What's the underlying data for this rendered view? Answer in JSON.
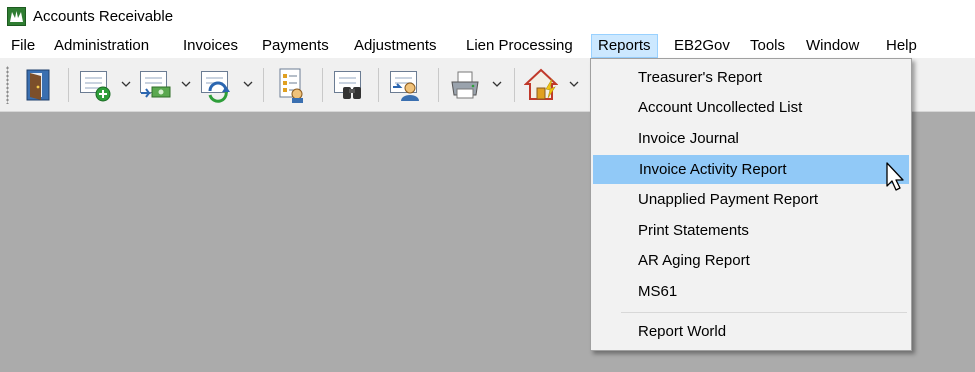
{
  "window": {
    "title": "Accounts Receivable",
    "app_icon": "app-logo-icon"
  },
  "menubar": {
    "items": [
      {
        "label": "File"
      },
      {
        "label": "Administration"
      },
      {
        "label": "Invoices"
      },
      {
        "label": "Payments"
      },
      {
        "label": "Adjustments"
      },
      {
        "label": "Lien Processing"
      },
      {
        "label": "Reports"
      },
      {
        "label": "EB2Gov"
      },
      {
        "label": "Tools"
      },
      {
        "label": "Window"
      },
      {
        "label": "Help"
      }
    ],
    "active": "Reports"
  },
  "toolbar": {
    "buttons": [
      {
        "icon": "exit-door-icon"
      },
      {
        "icon": "new-invoice-icon",
        "dropdown": true
      },
      {
        "icon": "payment-icon",
        "dropdown": true
      },
      {
        "icon": "adjustment-icon",
        "dropdown": true
      },
      {
        "icon": "checklist-icon"
      },
      {
        "icon": "search-binoculars-icon"
      },
      {
        "icon": "customer-icon"
      },
      {
        "icon": "printer-icon",
        "dropdown": true
      },
      {
        "icon": "home-icon",
        "dropdown": true
      }
    ]
  },
  "reports_menu": {
    "items": [
      {
        "label": "Treasurer's Report"
      },
      {
        "label": "Account Uncollected List"
      },
      {
        "label": "Invoice Journal"
      },
      {
        "label": "Invoice Activity Report",
        "highlighted": true
      },
      {
        "label": "Unapplied Payment Report"
      },
      {
        "label": "Print Statements"
      },
      {
        "label": "AR Aging Report"
      },
      {
        "label": "MS61"
      },
      {
        "label": "Report World"
      }
    ],
    "highlight_color": "#91c9f7"
  },
  "colors": {
    "workspace": "#ababab",
    "toolbar": "#f0f0f0",
    "menu_bg": "#f2f2f2"
  }
}
